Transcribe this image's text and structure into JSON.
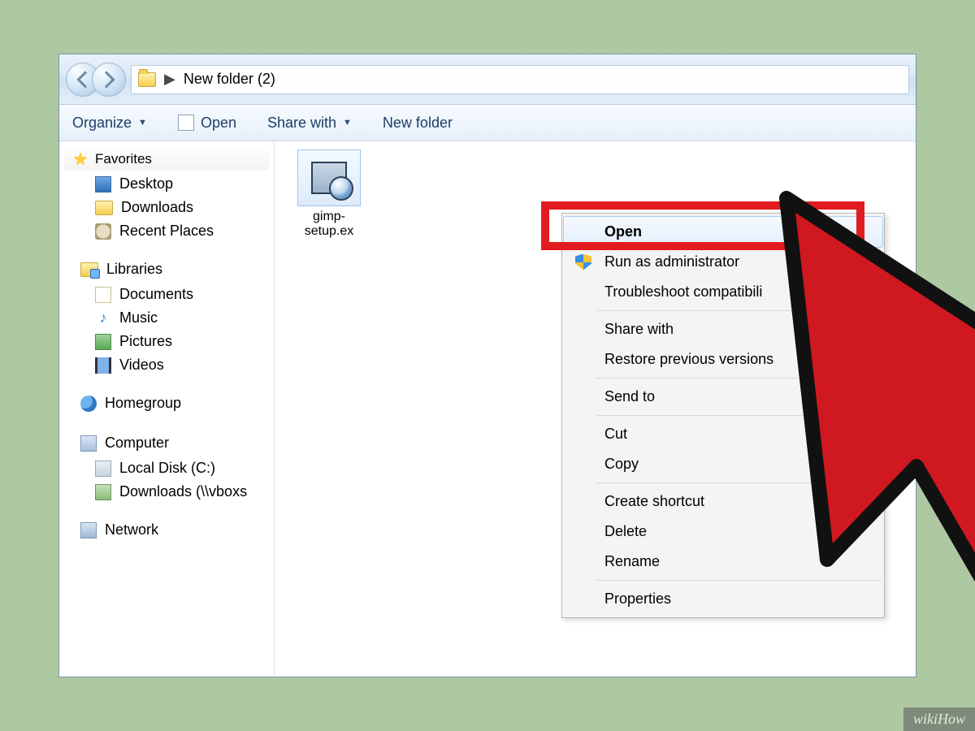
{
  "address": {
    "location": "New folder (2)"
  },
  "toolbar": {
    "organize": "Organize",
    "open": "Open",
    "share": "Share with",
    "newfolder": "New folder"
  },
  "sidebar": {
    "favorites": {
      "label": "Favorites",
      "items": [
        "Desktop",
        "Downloads",
        "Recent Places"
      ]
    },
    "libraries": {
      "label": "Libraries",
      "items": [
        "Documents",
        "Music",
        "Pictures",
        "Videos"
      ]
    },
    "homegroup": {
      "label": "Homegroup"
    },
    "computer": {
      "label": "Computer",
      "items": [
        "Local Disk (C:)",
        "Downloads (\\\\vboxs"
      ]
    },
    "network": {
      "label": "Network"
    }
  },
  "file": {
    "name_line1": "gimp-",
    "name_line2": "setup.ex"
  },
  "contextmenu": {
    "open": "Open",
    "runadmin": "Run as administrator",
    "troubleshoot": "Troubleshoot compatibili",
    "sharewith": "Share with",
    "restore": "Restore previous versions",
    "sendto": "Send to",
    "cut": "Cut",
    "copy": "Copy",
    "shortcut": "Create shortcut",
    "delete": "Delete",
    "rename": "Rename",
    "properties": "Properties"
  },
  "watermark": "wikiHow"
}
